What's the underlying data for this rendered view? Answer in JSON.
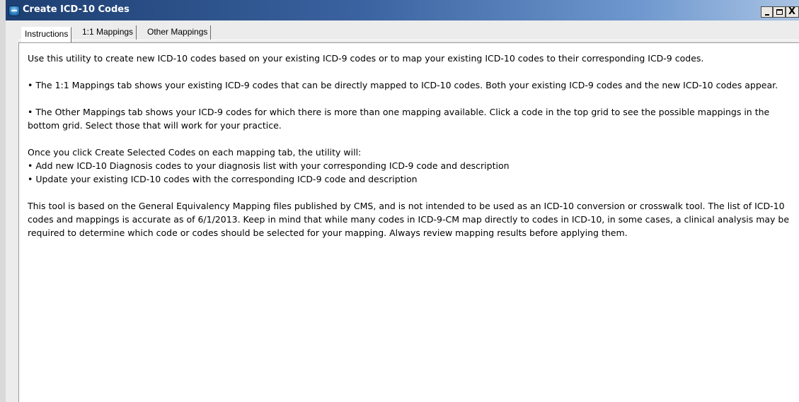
{
  "window": {
    "title": "Create ICD-10 Codes",
    "controls": {
      "minimize": "_",
      "maximize": "□",
      "close": "X"
    }
  },
  "tabs": [
    {
      "label": "Instructions",
      "active": true
    },
    {
      "label": "1:1 Mappings",
      "active": false
    },
    {
      "label": "Other Mappings",
      "active": false
    }
  ],
  "content": {
    "intro": "Use this utility to create new ICD-10 codes based on your existing ICD-9 codes or to map your existing ICD-10 codes to their corresponding ICD-9 codes.",
    "bullet_one_to_one": "• The 1:1 Mappings tab shows your existing ICD-9 codes that can be directly mapped to ICD-10 codes.  Both your existing ICD-9 codes and the new ICD-10 codes appear.",
    "bullet_other": "• The Other Mappings tab shows your ICD-9 codes for which there is more than one mapping available.  Click a code in the top grid to see the possible mappings in the bottom grid.  Select those that will work for your practice.",
    "create_intro": "Once you click Create Selected Codes on each mapping tab, the utility will:",
    "create_steps": [
      "• Add new ICD-10 Diagnosis codes to your diagnosis list with your corresponding ICD-9 code and description",
      "• Update your existing ICD-10 codes with the corresponding ICD-9 code and description"
    ],
    "disclaimer": "This tool is based on the General Equivalency Mapping files published by CMS, and is not intended to be used as an ICD-10 conversion or crosswalk tool.  The list of ICD-10 codes and mappings is accurate as of 6/1/2013.  Keep in mind that while many codes in ICD-9-CM map directly to codes in ICD-10, in some cases, a clinical analysis may be required to determine which code or codes should be selected for your mapping.  Always review mapping results before applying them."
  }
}
